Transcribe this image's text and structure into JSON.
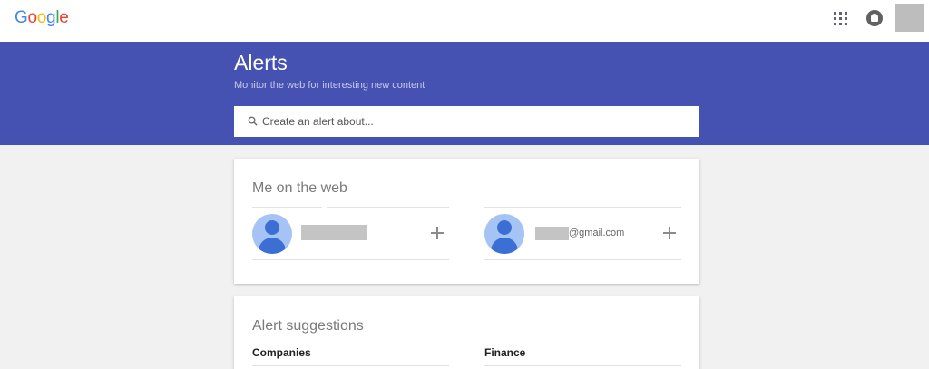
{
  "header": {
    "logo_letters": [
      "G",
      "o",
      "o",
      "g",
      "l",
      "e"
    ],
    "apps_icon": "apps-grid-icon",
    "notifications_icon": "notifications-icon",
    "account_icon": "account-avatar"
  },
  "hero": {
    "title": "Alerts",
    "subtitle": "Monitor the web for interesting new content",
    "search": {
      "placeholder": "Create an alert about...",
      "value": ""
    },
    "background_color": "#4652b2"
  },
  "me_on_the_web": {
    "title": "Me on the web",
    "entries": [
      {
        "label": "",
        "icon": "person-icon",
        "action_icon": "add-icon"
      },
      {
        "label": "@gmail.com",
        "icon": "person-icon",
        "action_icon": "add-icon"
      }
    ]
  },
  "alert_suggestions": {
    "title": "Alert suggestions",
    "columns": [
      "Companies",
      "Finance"
    ]
  }
}
